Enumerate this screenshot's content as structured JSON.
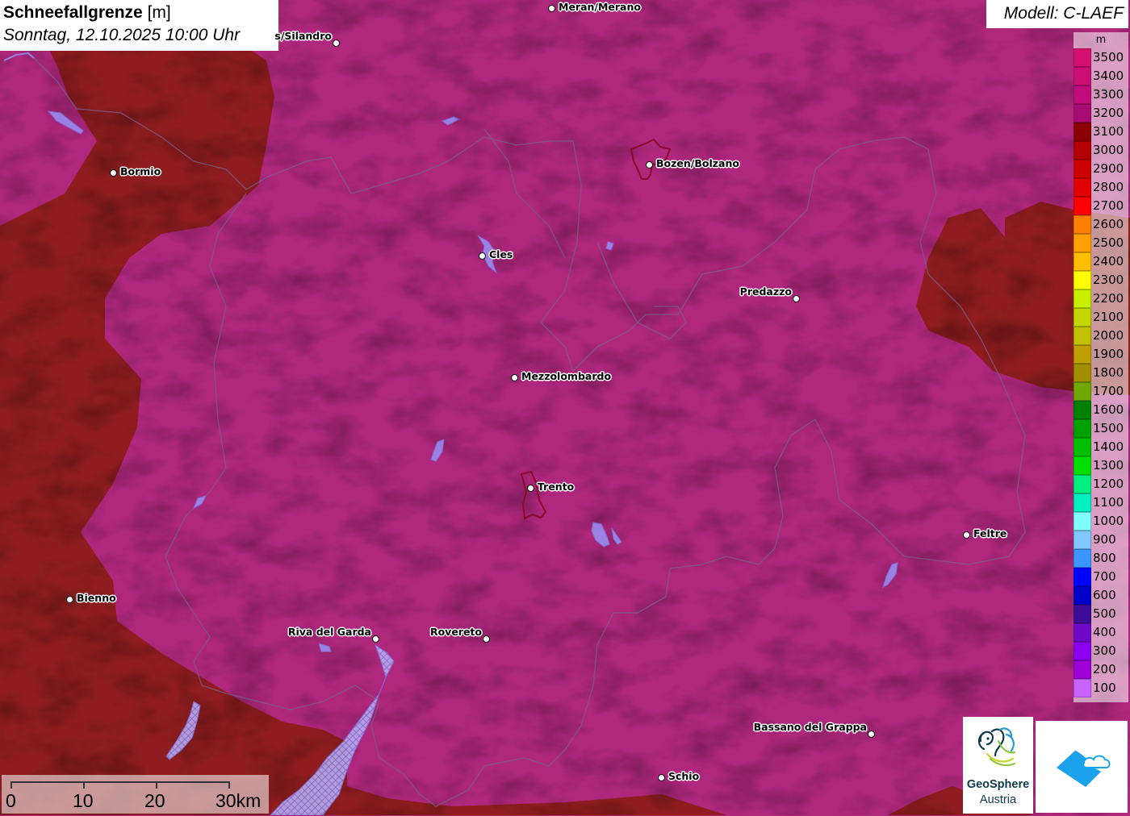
{
  "header": {
    "title": "Schneefallgrenze",
    "unit": "[m]",
    "datetime": "Sonntag, 12.10.2025 10:00 Uhr"
  },
  "model": {
    "label": "Modell: C-LAEF"
  },
  "legend": {
    "unit": "m",
    "entries": [
      {
        "value": "3500",
        "color": "#d40f6e"
      },
      {
        "value": "3400",
        "color": "#cc0f77"
      },
      {
        "value": "3300",
        "color": "#c20c7c"
      },
      {
        "value": "3200",
        "color": "#a80a73"
      },
      {
        "value": "3100",
        "color": "#8b0000"
      },
      {
        "value": "3000",
        "color": "#b30000"
      },
      {
        "value": "2900",
        "color": "#cc0000"
      },
      {
        "value": "2800",
        "color": "#e00000"
      },
      {
        "value": "2700",
        "color": "#ff0000"
      },
      {
        "value": "2600",
        "color": "#ff7f00"
      },
      {
        "value": "2500",
        "color": "#ff9f00"
      },
      {
        "value": "2400",
        "color": "#ffbf00"
      },
      {
        "value": "2300",
        "color": "#ffff00"
      },
      {
        "value": "2200",
        "color": "#c6f000"
      },
      {
        "value": "2100",
        "color": "#c2d800"
      },
      {
        "value": "2000",
        "color": "#c2c000"
      },
      {
        "value": "1900",
        "color": "#c0a000"
      },
      {
        "value": "1800",
        "color": "#a09000"
      },
      {
        "value": "1700",
        "color": "#6ea800"
      },
      {
        "value": "1600",
        "color": "#008000"
      },
      {
        "value": "1500",
        "color": "#00a000"
      },
      {
        "value": "1400",
        "color": "#00c000"
      },
      {
        "value": "1300",
        "color": "#00e000"
      },
      {
        "value": "1200",
        "color": "#00f080"
      },
      {
        "value": "1100",
        "color": "#00f0c0"
      },
      {
        "value": "1000",
        "color": "#80ffff"
      },
      {
        "value": "900",
        "color": "#80c8ff"
      },
      {
        "value": "800",
        "color": "#3c96ff"
      },
      {
        "value": "700",
        "color": "#0000ff"
      },
      {
        "value": "600",
        "color": "#0000c8"
      },
      {
        "value": "500",
        "color": "#3c0c96"
      },
      {
        "value": "400",
        "color": "#6e0ac8"
      },
      {
        "value": "300",
        "color": "#8c00f0"
      },
      {
        "value": "200",
        "color": "#a000d8"
      },
      {
        "value": "100",
        "color": "#c864ff"
      }
    ]
  },
  "cities": [
    {
      "name": "Meran/Merano",
      "label_side": "right"
    },
    {
      "name": "s/Silandro",
      "label_side": "left"
    },
    {
      "name": "Bormio",
      "label_side": "right"
    },
    {
      "name": "Bozen/Bolzano",
      "label_side": "right"
    },
    {
      "name": "Cles",
      "label_side": "right"
    },
    {
      "name": "Predazzo",
      "label_side": "left"
    },
    {
      "name": "Mezzolombardo",
      "label_side": "right"
    },
    {
      "name": "Trento",
      "label_side": "right"
    },
    {
      "name": "Feltre",
      "label_side": "right"
    },
    {
      "name": "Bienno",
      "label_side": "right"
    },
    {
      "name": "Riva del Garda",
      "label_side": "left"
    },
    {
      "name": "Rovereto",
      "label_side": "left"
    },
    {
      "name": "Bassano del Grappa",
      "label_side": "left"
    },
    {
      "name": "Schio",
      "label_side": "right"
    }
  ],
  "scalebar": {
    "labels": [
      "0",
      "10",
      "20",
      "30km"
    ]
  },
  "logos": {
    "geosphere_line1": "GeoSphere",
    "geosphere_line2": "Austria"
  },
  "colors": {
    "snowline_high": "#b0287e",
    "snowline_lower": "#8b1a1a",
    "lakes": "#9a8cf0",
    "borders": "#7a5a8a"
  }
}
